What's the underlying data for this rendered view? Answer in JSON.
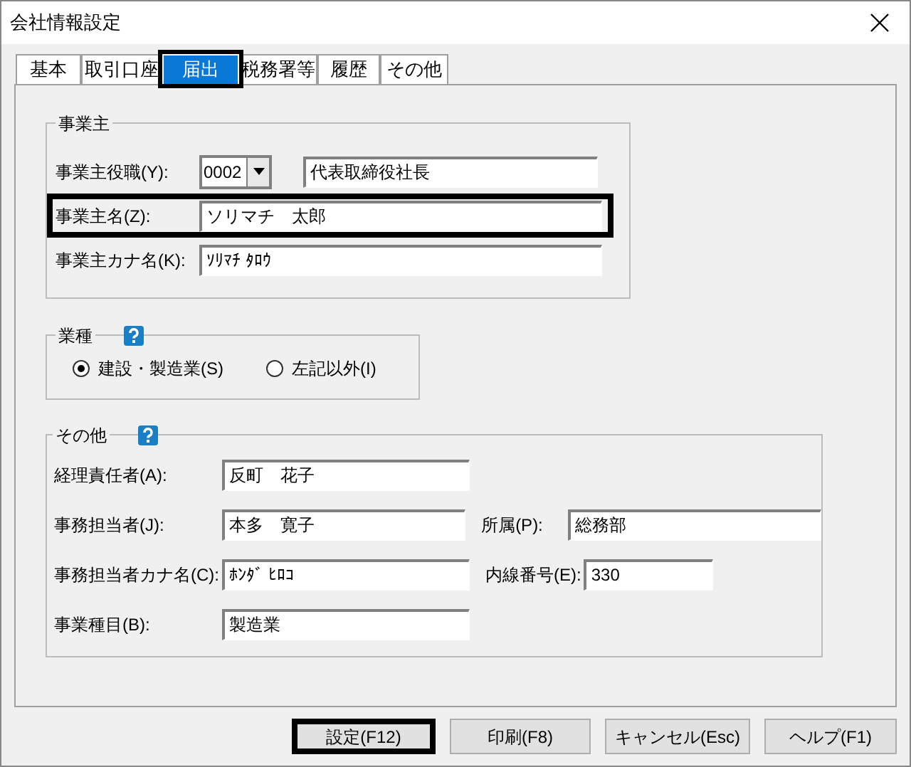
{
  "window": {
    "title": "会社情報設定"
  },
  "tabs": [
    {
      "label": "基本",
      "selected": false,
      "highlighted": false
    },
    {
      "label": "取引口座",
      "selected": false,
      "highlighted": false
    },
    {
      "label": "届出",
      "selected": true,
      "highlighted": true
    },
    {
      "label": "税務署等",
      "selected": false,
      "highlighted": false
    },
    {
      "label": "履歴",
      "selected": false,
      "highlighted": false
    },
    {
      "label": "その他",
      "selected": false,
      "highlighted": false
    }
  ],
  "owner_group": {
    "title": "事業主",
    "fields": [
      {
        "kind": "combo",
        "label": "事業主役職(Y):",
        "code": "0002",
        "value": "代表取締役社長",
        "highlighted": false
      },
      {
        "kind": "text",
        "label": "事業主名(Z):",
        "value": "ソリマチ　太郎",
        "highlighted": true
      },
      {
        "kind": "text",
        "label": "事業主カナ名(K):",
        "value": "ｿﾘﾏﾁ ﾀﾛｳ",
        "highlighted": false
      }
    ]
  },
  "industry_group": {
    "title": "業種",
    "options": [
      {
        "label": "建設・製造業(S)",
        "selected": true
      },
      {
        "label": "左記以外(I)",
        "selected": false
      }
    ]
  },
  "other_group": {
    "title": "その他",
    "rows": [
      [
        {
          "label": "経理責任者(A):",
          "value": "反町　花子"
        }
      ],
      [
        {
          "label": "事務担当者(J):",
          "value": "本多　寛子"
        },
        {
          "label": "所属(P):",
          "value": "総務部"
        }
      ],
      [
        {
          "label": "事務担当者カナ名(C):",
          "value": "ﾎﾝﾀﾞ ﾋﾛｺ"
        },
        {
          "label": "内線番号(E):",
          "value": "330"
        }
      ],
      [
        {
          "label": "事業種目(B):",
          "value": "製造業"
        }
      ]
    ]
  },
  "buttons": [
    {
      "label": "設定(F12)",
      "highlighted": true
    },
    {
      "label": "印刷(F8)",
      "highlighted": false
    },
    {
      "label": "キャンセル(Esc)",
      "highlighted": false
    },
    {
      "label": "ヘルプ(F1)",
      "highlighted": false
    }
  ]
}
